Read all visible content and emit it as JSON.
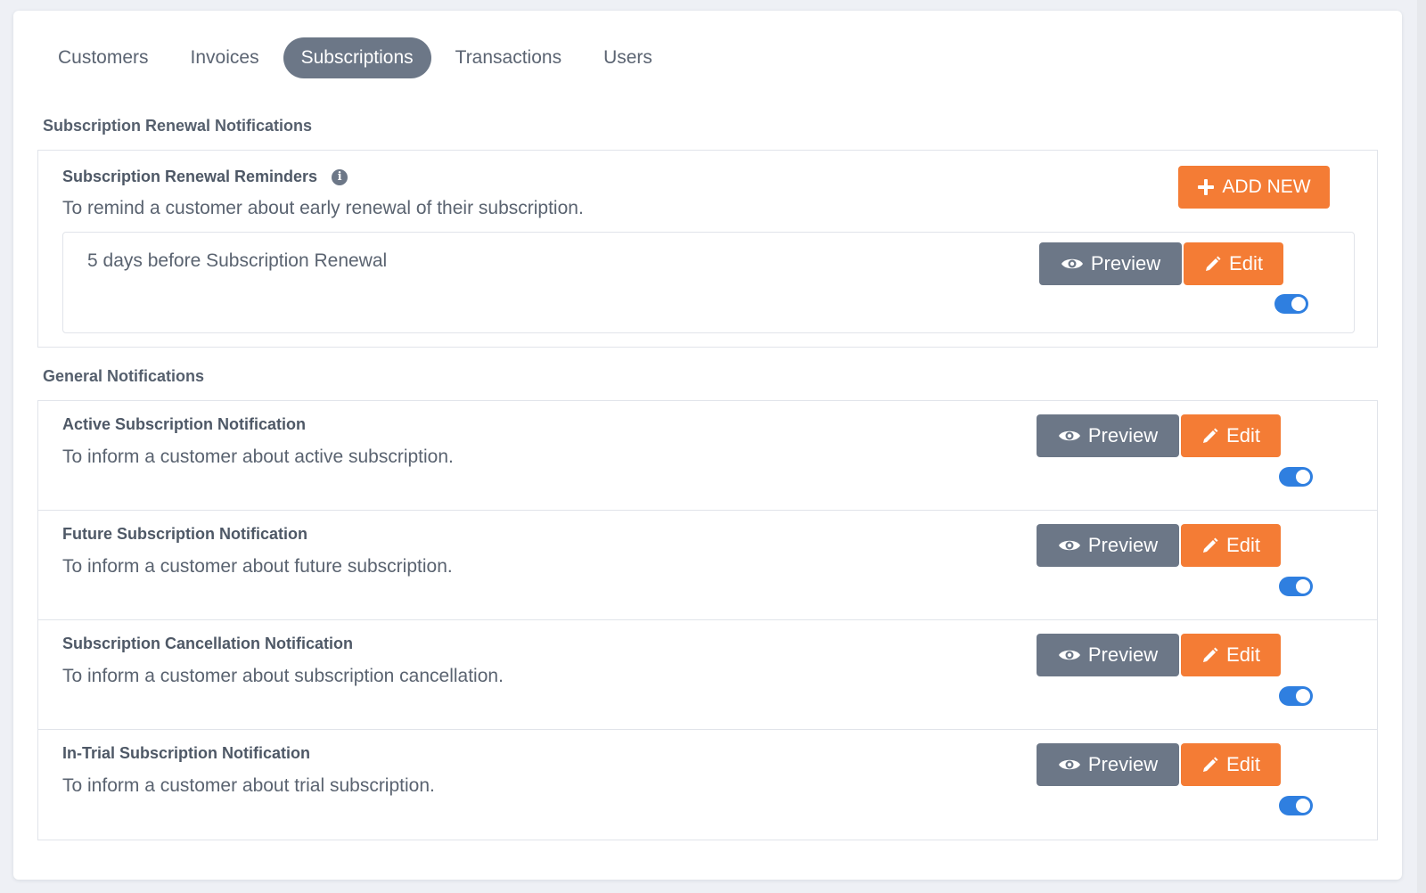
{
  "tabs": [
    {
      "label": "Customers",
      "active": false
    },
    {
      "label": "Invoices",
      "active": false
    },
    {
      "label": "Subscriptions",
      "active": true
    },
    {
      "label": "Transactions",
      "active": false
    },
    {
      "label": "Users",
      "active": false
    }
  ],
  "renewal": {
    "section_title": "Subscription Renewal Notifications",
    "title": "Subscription Renewal Reminders",
    "description": "To remind a customer about early renewal of their subscription.",
    "add_label": "ADD NEW",
    "reminder": {
      "label": "5 days before Subscription Renewal",
      "preview_label": "Preview",
      "edit_label": "Edit",
      "enabled": true
    }
  },
  "general": {
    "section_title": "General Notifications",
    "items": [
      {
        "title": "Active Subscription Notification",
        "description": "To inform a customer about active subscription.",
        "preview_label": "Preview",
        "edit_label": "Edit",
        "enabled": true
      },
      {
        "title": "Future Subscription Notification",
        "description": "To inform a customer about future subscription.",
        "preview_label": "Preview",
        "edit_label": "Edit",
        "enabled": true
      },
      {
        "title": "Subscription Cancellation Notification",
        "description": "To inform a customer about subscription cancellation.",
        "preview_label": "Preview",
        "edit_label": "Edit",
        "enabled": true
      },
      {
        "title": "In-Trial Subscription Notification",
        "description": "To inform a customer about trial subscription.",
        "preview_label": "Preview",
        "edit_label": "Edit",
        "enabled": true
      }
    ]
  },
  "colors": {
    "accent_orange": "#f47c35",
    "slate": "#6c7787",
    "toggle_blue": "#2f7fe0"
  },
  "icons": {
    "preview": "eye-icon",
    "edit": "pencil-icon",
    "add": "plus-icon",
    "info": "info-icon"
  }
}
